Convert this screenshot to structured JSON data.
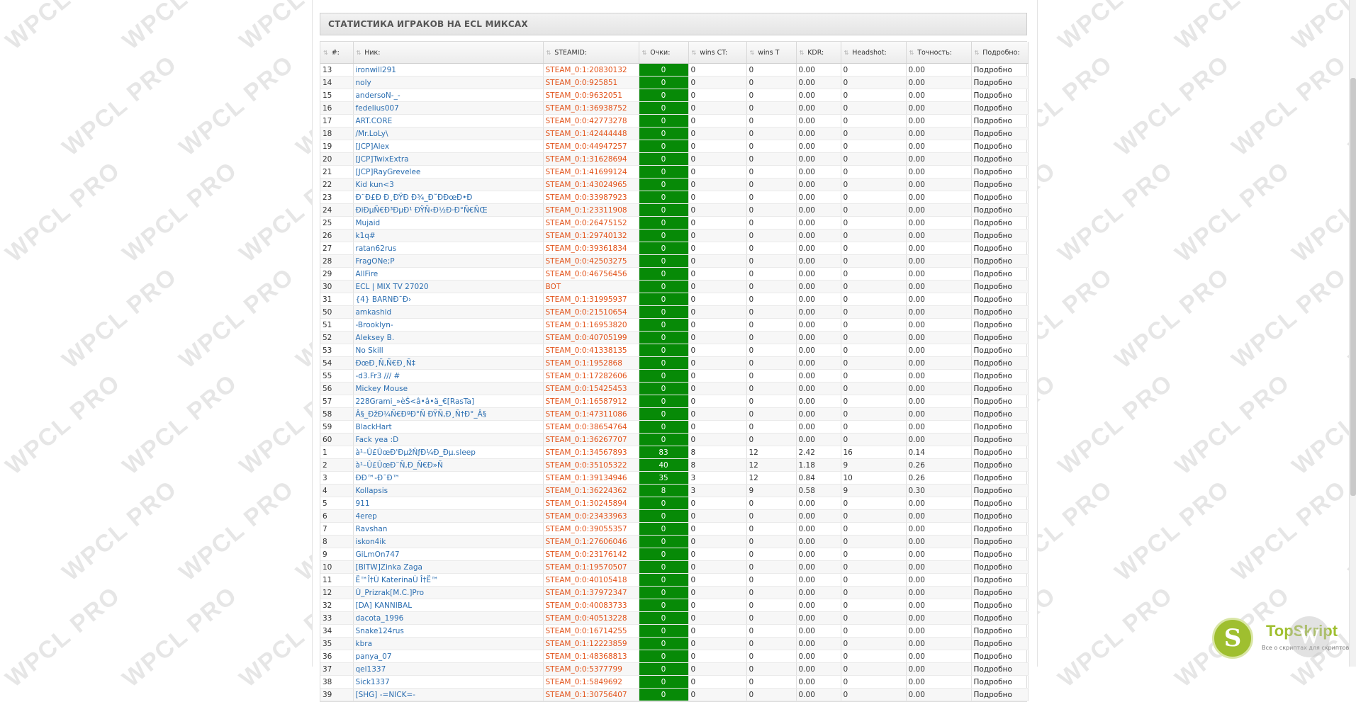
{
  "panel": {
    "title": "СТАТИСТИКА ИГРАКОВ НА ECL МИКСАХ"
  },
  "watermark": "WPCL PRO",
  "columns": [
    "#:",
    "Ник:",
    "STEAMID:",
    "Очки:",
    "wins CT:",
    "wins T",
    "KDR:",
    "Headshot:",
    "Точность:",
    "Подробно:"
  ],
  "rows": [
    {
      "n": "13",
      "nick": "ironwill291",
      "steam": "STEAM_0:1:20830132",
      "pts": "0",
      "ct": "0",
      "t": "0",
      "kdr": "0.00",
      "hs": "0",
      "acc": "0.00",
      "more": "Подробно"
    },
    {
      "n": "14",
      "nick": "noly",
      "steam": "STEAM_0:0:925851",
      "pts": "0",
      "ct": "0",
      "t": "0",
      "kdr": "0.00",
      "hs": "0",
      "acc": "0.00",
      "more": "Подробно"
    },
    {
      "n": "15",
      "nick": "andersoN-_-",
      "steam": "STEAM_0:0:9632051",
      "pts": "0",
      "ct": "0",
      "t": "0",
      "kdr": "0.00",
      "hs": "0",
      "acc": "0.00",
      "more": "Подробно"
    },
    {
      "n": "16",
      "nick": "fedelius007",
      "steam": "STEAM_0:1:36938752",
      "pts": "0",
      "ct": "0",
      "t": "0",
      "kdr": "0.00",
      "hs": "0",
      "acc": "0.00",
      "more": "Подробно"
    },
    {
      "n": "17",
      "nick": "ART.CORE",
      "steam": "STEAM_0:0:42773278",
      "pts": "0",
      "ct": "0",
      "t": "0",
      "kdr": "0.00",
      "hs": "0",
      "acc": "0.00",
      "more": "Подробно"
    },
    {
      "n": "18",
      "nick": "/Mr.LoLy\\",
      "steam": "STEAM_0:1:42444448",
      "pts": "0",
      "ct": "0",
      "t": "0",
      "kdr": "0.00",
      "hs": "0",
      "acc": "0.00",
      "more": "Подробно"
    },
    {
      "n": "19",
      "nick": "[JCP]Alex",
      "steam": "STEAM_0:0:44947257",
      "pts": "0",
      "ct": "0",
      "t": "0",
      "kdr": "0.00",
      "hs": "0",
      "acc": "0.00",
      "more": "Подробно"
    },
    {
      "n": "20",
      "nick": "[JCP]TwixExtra",
      "steam": "STEAM_0:1:31628694",
      "pts": "0",
      "ct": "0",
      "t": "0",
      "kdr": "0.00",
      "hs": "0",
      "acc": "0.00",
      "more": "Подробно"
    },
    {
      "n": "21",
      "nick": "[JCP]RayGrevelee",
      "steam": "STEAM_0:1:41699124",
      "pts": "0",
      "ct": "0",
      "t": "0",
      "kdr": "0.00",
      "hs": "0",
      "acc": "0.00",
      "more": "Подробно"
    },
    {
      "n": "22",
      "nick": "Kid kun<3",
      "steam": "STEAM_0:1:43024965",
      "pts": "0",
      "ct": "0",
      "t": "0",
      "kdr": "0.00",
      "hs": "0",
      "acc": "0.00",
      "more": "Подробно"
    },
    {
      "n": "23",
      "nick": "Ð¨Ð£Ð Ð¸ÐŸÐ Ð¾_Ð˜ÐÐœÐ•Ð",
      "steam": "STEAM_0:0:33987923",
      "pts": "0",
      "ct": "0",
      "t": "0",
      "kdr": "0.00",
      "hs": "0",
      "acc": "0.00",
      "more": "Подробно"
    },
    {
      "n": "24",
      "nick": "ÐiÐµÑ€Ð³ÐµÐ¹ ÐŸÑ‹Ð½Ð·Ð°Ñ€ÑŒ",
      "steam": "STEAM_0:1:23311908",
      "pts": "0",
      "ct": "0",
      "t": "0",
      "kdr": "0.00",
      "hs": "0",
      "acc": "0.00",
      "more": "Подробно"
    },
    {
      "n": "25",
      "nick": "Mujaid",
      "steam": "STEAM_0:0:26475152",
      "pts": "0",
      "ct": "0",
      "t": "0",
      "kdr": "0.00",
      "hs": "0",
      "acc": "0.00",
      "more": "Подробно"
    },
    {
      "n": "26",
      "nick": "k1q#",
      "steam": "STEAM_0:1:29740132",
      "pts": "0",
      "ct": "0",
      "t": "0",
      "kdr": "0.00",
      "hs": "0",
      "acc": "0.00",
      "more": "Подробно"
    },
    {
      "n": "27",
      "nick": "ratan62rus",
      "steam": "STEAM_0:0:39361834",
      "pts": "0",
      "ct": "0",
      "t": "0",
      "kdr": "0.00",
      "hs": "0",
      "acc": "0.00",
      "more": "Подробно"
    },
    {
      "n": "28",
      "nick": "FragONe;P",
      "steam": "STEAM_0:0:42503275",
      "pts": "0",
      "ct": "0",
      "t": "0",
      "kdr": "0.00",
      "hs": "0",
      "acc": "0.00",
      "more": "Подробно"
    },
    {
      "n": "29",
      "nick": "AllFire",
      "steam": "STEAM_0:0:46756456",
      "pts": "0",
      "ct": "0",
      "t": "0",
      "kdr": "0.00",
      "hs": "0",
      "acc": "0.00",
      "more": "Подробно"
    },
    {
      "n": "30",
      "nick": "ECL | MIX TV 27020",
      "steam": "BOT",
      "pts": "0",
      "ct": "0",
      "t": "0",
      "kdr": "0.00",
      "hs": "0",
      "acc": "0.00",
      "more": "Подробно"
    },
    {
      "n": "31",
      "nick": "{4} BARNÐ¯Ð›",
      "steam": "STEAM_0:1:31995937",
      "pts": "0",
      "ct": "0",
      "t": "0",
      "kdr": "0.00",
      "hs": "0",
      "acc": "0.00",
      "more": "Подробно"
    },
    {
      "n": "50",
      "nick": "amkashid",
      "steam": "STEAM_0:0:21510654",
      "pts": "0",
      "ct": "0",
      "t": "0",
      "kdr": "0.00",
      "hs": "0",
      "acc": "0.00",
      "more": "Подробно"
    },
    {
      "n": "51",
      "nick": "-Brooklyn-",
      "steam": "STEAM_0:1:16953820",
      "pts": "0",
      "ct": "0",
      "t": "0",
      "kdr": "0.00",
      "hs": "0",
      "acc": "0.00",
      "more": "Подробно"
    },
    {
      "n": "52",
      "nick": "Aleksey B.",
      "steam": "STEAM_0:0:40705199",
      "pts": "0",
      "ct": "0",
      "t": "0",
      "kdr": "0.00",
      "hs": "0",
      "acc": "0.00",
      "more": "Подробно"
    },
    {
      "n": "53",
      "nick": "No Skill",
      "steam": "STEAM_0:0:41338135",
      "pts": "0",
      "ct": "0",
      "t": "0",
      "kdr": "0.00",
      "hs": "0",
      "acc": "0.00",
      "more": "Подробно"
    },
    {
      "n": "54",
      "nick": "ÐœÐ¸Ñ‚Ñ€Ð¸Ñ‡",
      "steam": "STEAM_0:1:1952868",
      "pts": "0",
      "ct": "0",
      "t": "0",
      "kdr": "0.00",
      "hs": "0",
      "acc": "0.00",
      "more": "Подробно"
    },
    {
      "n": "55",
      "nick": "-d3.Fr3 /// #",
      "steam": "STEAM_0:1:17282606",
      "pts": "0",
      "ct": "0",
      "t": "0",
      "kdr": "0.00",
      "hs": "0",
      "acc": "0.00",
      "more": "Подробно"
    },
    {
      "n": "56",
      "nick": "Mickey Mouse",
      "steam": "STEAM_0:0:15425453",
      "pts": "0",
      "ct": "0",
      "t": "0",
      "kdr": "0.00",
      "hs": "0",
      "acc": "0.00",
      "more": "Подробно"
    },
    {
      "n": "57",
      "nick": "228Grami_»èŠ<â•â•ä_€[RasTa]",
      "steam": "STEAM_0:1:16587912",
      "pts": "0",
      "ct": "0",
      "t": "0",
      "kdr": "0.00",
      "hs": "0",
      "acc": "0.00",
      "more": "Подробно"
    },
    {
      "n": "58",
      "nick": "Â§_ÐžÐ¼Ñ€ÐºÐ°Ñ ÐŸÑ‚Ð¸Ñ†Ð°_Â§",
      "steam": "STEAM_0:1:47311086",
      "pts": "0",
      "ct": "0",
      "t": "0",
      "kdr": "0.00",
      "hs": "0",
      "acc": "0.00",
      "more": "Подробно"
    },
    {
      "n": "59",
      "nick": "BlackHart",
      "steam": "STEAM_0:0:38654764",
      "pts": "0",
      "ct": "0",
      "t": "0",
      "kdr": "0.00",
      "hs": "0",
      "acc": "0.00",
      "more": "Подробно"
    },
    {
      "n": "60",
      "nick": "Fack yea :D",
      "steam": "STEAM_0:1:36267707",
      "pts": "0",
      "ct": "0",
      "t": "0",
      "kdr": "0.00",
      "hs": "0",
      "acc": "0.00",
      "more": "Подробно"
    },
    {
      "n": "1",
      "nick": "à¹–Û£ÛœÐ'ÐµžÑƒÐ¼Ð_Ðµ.sleep",
      "steam": "STEAM_0:1:34567893",
      "pts": "83",
      "ct": "8",
      "t": "12",
      "kdr": "2.42",
      "hs": "16",
      "acc": "0.14",
      "more": "Подробно"
    },
    {
      "n": "2",
      "nick": "à¹–Û£ÛœÐ¨Ñ‚Ð_Ñ€Ð»Ñ",
      "steam": "STEAM_0:0:35105322",
      "pts": "40",
      "ct": "8",
      "t": "12",
      "kdr": "1.18",
      "hs": "9",
      "acc": "0.26",
      "more": "Подробно"
    },
    {
      "n": "3",
      "nick": "ÐÐ™-Ð¯Ð™",
      "steam": "STEAM_0:1:39134946",
      "pts": "35",
      "ct": "3",
      "t": "12",
      "kdr": "0.84",
      "hs": "10",
      "acc": "0.26",
      "more": "Подробно"
    },
    {
      "n": "4",
      "nick": "Kollapsis",
      "steam": "STEAM_0:1:36224362",
      "pts": "8",
      "ct": "3",
      "t": "9",
      "kdr": "0.58",
      "hs": "9",
      "acc": "0.30",
      "more": "Подробно"
    },
    {
      "n": "5",
      "nick": "911",
      "steam": "STEAM_0:1:30245894",
      "pts": "0",
      "ct": "0",
      "t": "0",
      "kdr": "0.00",
      "hs": "0",
      "acc": "0.00",
      "more": "Подробно"
    },
    {
      "n": "6",
      "nick": "4erep",
      "steam": "STEAM_0:0:23433963",
      "pts": "0",
      "ct": "0",
      "t": "0",
      "kdr": "0.00",
      "hs": "0",
      "acc": "0.00",
      "more": "Подробно"
    },
    {
      "n": "7",
      "nick": "Ravshan",
      "steam": "STEAM_0:0:39055357",
      "pts": "0",
      "ct": "0",
      "t": "0",
      "kdr": "0.00",
      "hs": "0",
      "acc": "0.00",
      "more": "Подробно"
    },
    {
      "n": "8",
      "nick": "iskon4ik",
      "steam": "STEAM_0:1:27606046",
      "pts": "0",
      "ct": "0",
      "t": "0",
      "kdr": "0.00",
      "hs": "0",
      "acc": "0.00",
      "more": "Подробно"
    },
    {
      "n": "9",
      "nick": "GiLmOn747",
      "steam": "STEAM_0:0:23176142",
      "pts": "0",
      "ct": "0",
      "t": "0",
      "kdr": "0.00",
      "hs": "0",
      "acc": "0.00",
      "more": "Подробно"
    },
    {
      "n": "10",
      "nick": "[BITW]Zinka Zaga",
      "steam": "STEAM_0:1:19570507",
      "pts": "0",
      "ct": "0",
      "t": "0",
      "kdr": "0.00",
      "hs": "0",
      "acc": "0.00",
      "more": "Подробно"
    },
    {
      "n": "11",
      "nick": "Ë™Î†Ù KaterinaÙ Î†Ë™",
      "steam": "STEAM_0:0:40105418",
      "pts": "0",
      "ct": "0",
      "t": "0",
      "kdr": "0.00",
      "hs": "0",
      "acc": "0.00",
      "more": "Подробно"
    },
    {
      "n": "12",
      "nick": "Ù_Prizrak[M.C.]Pro",
      "steam": "STEAM_0:1:37972347",
      "pts": "0",
      "ct": "0",
      "t": "0",
      "kdr": "0.00",
      "hs": "0",
      "acc": "0.00",
      "more": "Подробно"
    },
    {
      "n": "32",
      "nick": "[DA] KANNIBAL",
      "steam": "STEAM_0:0:40083733",
      "pts": "0",
      "ct": "0",
      "t": "0",
      "kdr": "0.00",
      "hs": "0",
      "acc": "0.00",
      "more": "Подробно"
    },
    {
      "n": "33",
      "nick": "dacota_1996",
      "steam": "STEAM_0:0:40513228",
      "pts": "0",
      "ct": "0",
      "t": "0",
      "kdr": "0.00",
      "hs": "0",
      "acc": "0.00",
      "more": "Подробно"
    },
    {
      "n": "34",
      "nick": "Snake124rus",
      "steam": "STEAM_0:0:16714255",
      "pts": "0",
      "ct": "0",
      "t": "0",
      "kdr": "0.00",
      "hs": "0",
      "acc": "0.00",
      "more": "Подробно"
    },
    {
      "n": "35",
      "nick": "kbra",
      "steam": "STEAM_0:1:12223859",
      "pts": "0",
      "ct": "0",
      "t": "0",
      "kdr": "0.00",
      "hs": "0",
      "acc": "0.00",
      "more": "Подробно"
    },
    {
      "n": "36",
      "nick": "panya_07",
      "steam": "STEAM_0:1:48368813",
      "pts": "0",
      "ct": "0",
      "t": "0",
      "kdr": "0.00",
      "hs": "0",
      "acc": "0.00",
      "more": "Подробно"
    },
    {
      "n": "37",
      "nick": "qel1337",
      "steam": "STEAM_0:0:5377799",
      "pts": "0",
      "ct": "0",
      "t": "0",
      "kdr": "0.00",
      "hs": "0",
      "acc": "0.00",
      "more": "Подробно"
    },
    {
      "n": "38",
      "nick": "Sick1337",
      "steam": "STEAM_0:1:5849692",
      "pts": "0",
      "ct": "0",
      "t": "0",
      "kdr": "0.00",
      "hs": "0",
      "acc": "0.00",
      "more": "Подробно"
    },
    {
      "n": "39",
      "nick": "[SHG] -=NICK=-",
      "steam": "STEAM_0:1:30756407",
      "pts": "0",
      "ct": "0",
      "t": "0",
      "kdr": "0.00",
      "hs": "0",
      "acc": "0.00",
      "more": "Подробно"
    }
  ],
  "colors": {
    "points_bg": "#078a07",
    "nick": "#2a6db0",
    "steamid": "#e2531a"
  },
  "icons": {
    "sort": "sort-arrows-icon"
  },
  "badge": {
    "name": "TopSkript",
    "letter": "S",
    "tagline": "Все о скриптах для скриптов",
    "second_letter": "W"
  }
}
